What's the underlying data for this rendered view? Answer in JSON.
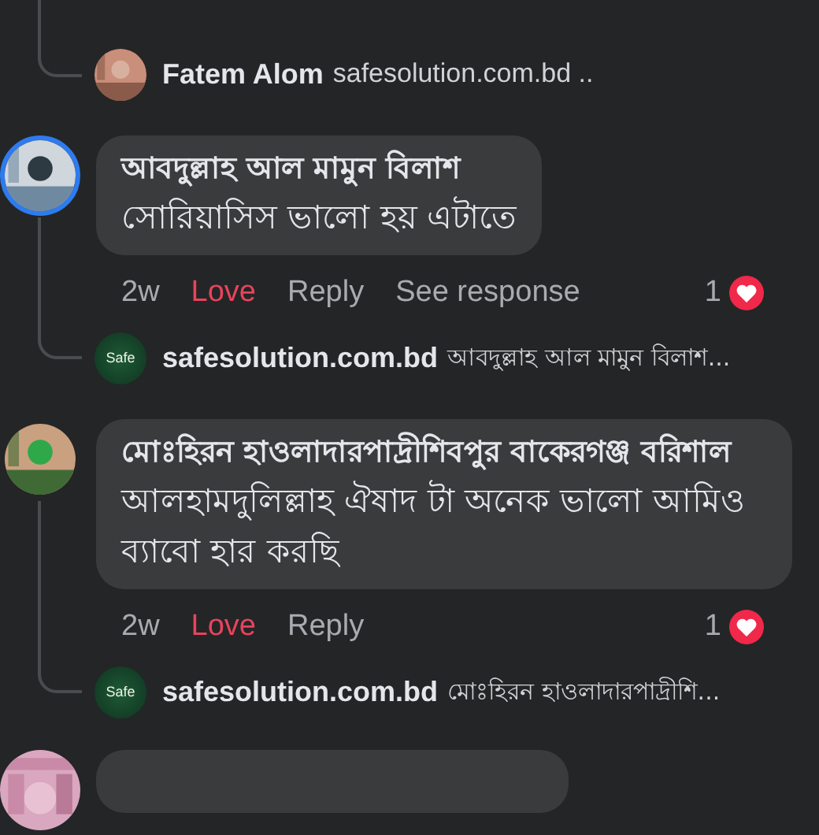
{
  "top": {
    "reply_preview": {
      "author": "Fatem Alom",
      "text": "safesolution.com.bd .."
    }
  },
  "comments": [
    {
      "author": "আবদুল্লাহ আল মামুন বিলাশ",
      "text": "সোরিয়াসিস ভালো হয় এটাতে",
      "story_ring": true,
      "actions": [
        {
          "kind": "time",
          "label": "2w"
        },
        {
          "kind": "react",
          "label": "Love",
          "reacted": true
        },
        {
          "kind": "reply",
          "label": "Reply"
        },
        {
          "kind": "link",
          "label": "See response"
        }
      ],
      "reaction_count": "1",
      "reply_preview": {
        "avatar": {
          "kind": "logo",
          "label": "Safe"
        },
        "author": "safesolution.com.bd",
        "text": "আবদুল্লাহ আল মামুন বিলাশ..."
      }
    },
    {
      "author": "মোঃহিরন হাওলাদারপাদ্রীশিবপুর বাকেরগঞ্জ বরিশাল",
      "text": "আলহামদুলিল্লাহ ঐষাদ টা অনেক ভালো আমিও ব্যাবো হার করছি",
      "story_ring": false,
      "actions": [
        {
          "kind": "time",
          "label": "2w"
        },
        {
          "kind": "react",
          "label": "Love",
          "reacted": true
        },
        {
          "kind": "reply",
          "label": "Reply"
        }
      ],
      "reaction_count": "1",
      "reply_preview": {
        "avatar": {
          "kind": "logo",
          "label": "Safe"
        },
        "author": "safesolution.com.bd",
        "text": "মোঃহিরন হাওলাদারপাদ্রীশি..."
      }
    }
  ]
}
